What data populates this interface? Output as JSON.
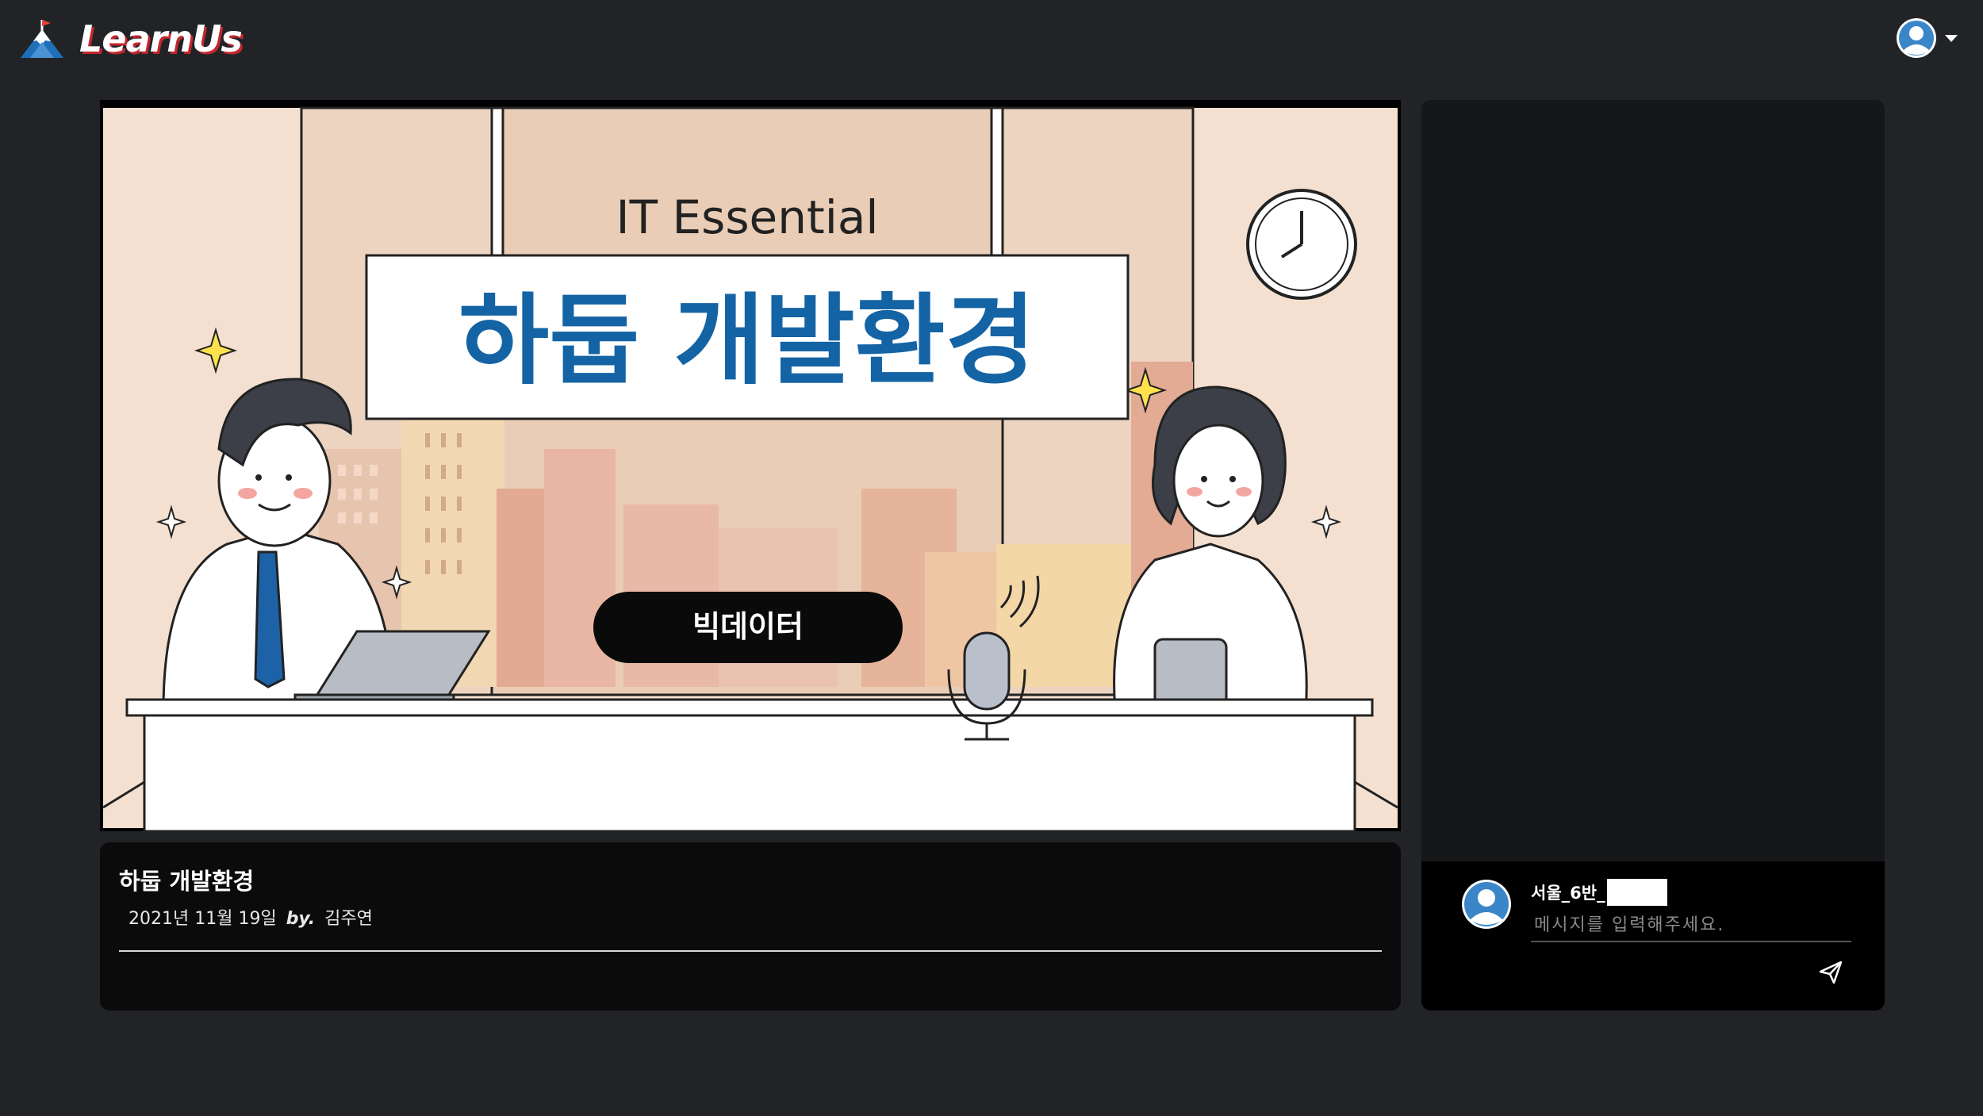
{
  "app": {
    "logo_text": "LearnUs",
    "logo_icon": "mountain-flag-icon",
    "profile_icon": "user-avatar-icon"
  },
  "video": {
    "subtitle": "IT Essential",
    "title": "하둡 개발환경",
    "tag": "빅데이터"
  },
  "lecture": {
    "title": "하둡 개발환경",
    "date": "2021년 11월 19일",
    "by_label": "by.",
    "author": "김주연"
  },
  "chat": {
    "username": "서울_6반_",
    "placeholder": "메시지를 입력해주세요.",
    "send_icon": "paper-plane-icon"
  },
  "colors": {
    "background": "#222327",
    "title_blue": "#1464a5",
    "panel": "#161719"
  }
}
